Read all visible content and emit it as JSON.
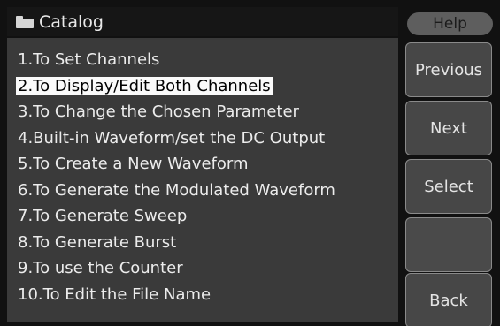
{
  "window": {
    "title": "Catalog",
    "icon": "folder-icon"
  },
  "help_label": "Help",
  "menu": [
    {
      "label": "1.To Set Channels",
      "selected": false
    },
    {
      "label": "2.To Display/Edit Both Channels",
      "selected": true
    },
    {
      "label": "3.To Change the Chosen Parameter",
      "selected": false
    },
    {
      "label": "4.Built-in Waveform/set the DC Output",
      "selected": false
    },
    {
      "label": "5.To Create a New Waveform",
      "selected": false
    },
    {
      "label": "6.To Generate the Modulated Waveform",
      "selected": false
    },
    {
      "label": "7.To Generate Sweep",
      "selected": false
    },
    {
      "label": "8.To Generate Burst",
      "selected": false
    },
    {
      "label": "9.To use the Counter",
      "selected": false
    },
    {
      "label": "10.To Edit the File Name",
      "selected": false
    }
  ],
  "softkeys": {
    "previous": "Previous",
    "next": "Next",
    "select": "Select",
    "blank": "",
    "back": "Back"
  },
  "colors": {
    "background": "#111111",
    "panel": "#3a3a3a",
    "selection": "#fafafa",
    "button": "#474747"
  }
}
